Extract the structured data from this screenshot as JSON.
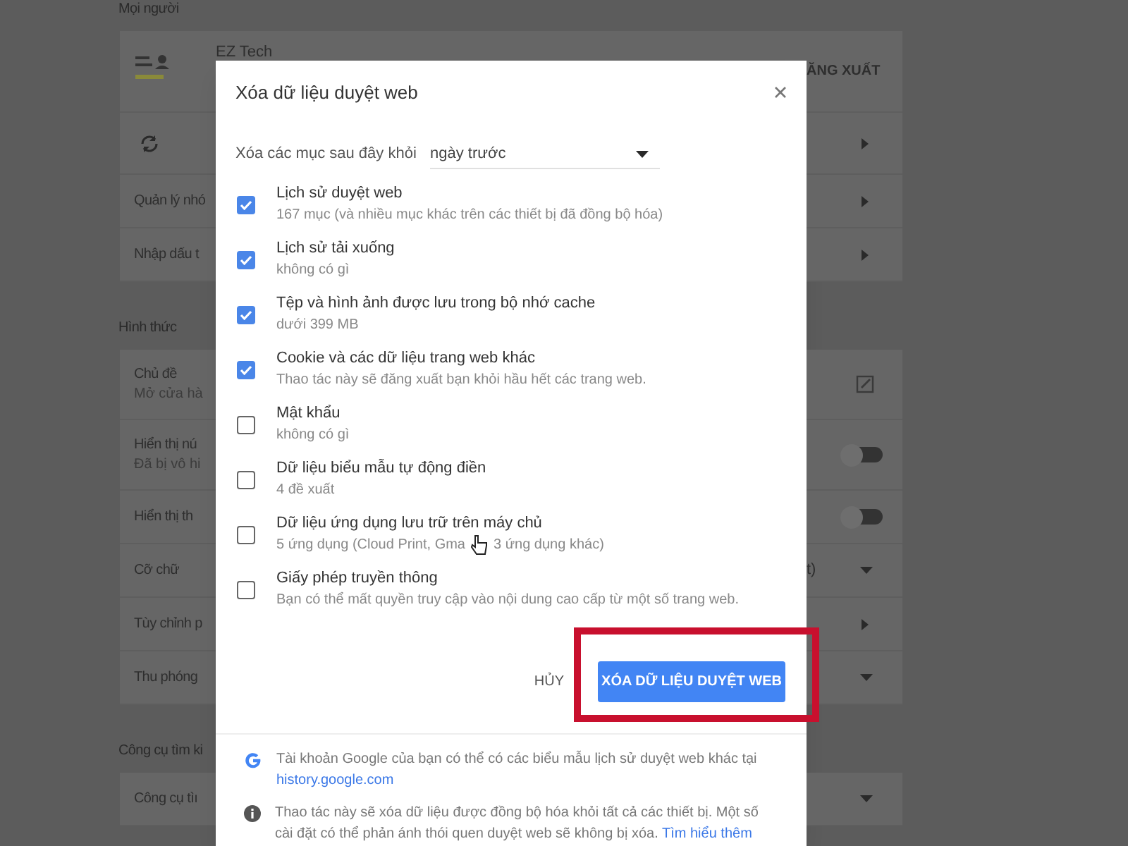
{
  "background": {
    "sections": [
      {
        "label": "Mọi người",
        "rows": [
          {
            "kind": "account",
            "label": "EZ Tech",
            "action": "ĂNG XUẤT"
          },
          {
            "kind": "sync"
          },
          {
            "kind": "link",
            "label": "Quản lý nhó"
          },
          {
            "kind": "link",
            "label": "Nhập dấu t"
          }
        ]
      },
      {
        "label": "Hình thức",
        "rows": [
          {
            "kind": "edit",
            "label": "Chủ đề",
            "sublabel": "Mở cửa hà"
          },
          {
            "kind": "toggle",
            "label": "Hiển thị nú",
            "sublabel": "Đã bị vô hi",
            "on": false
          },
          {
            "kind": "toggle",
            "label": "Hiển thị th",
            "on": false
          },
          {
            "kind": "select",
            "label": "Cỡ chữ",
            "value": "t)"
          },
          {
            "kind": "link",
            "label": "Tùy chỉnh p"
          },
          {
            "kind": "select",
            "label": "Thu phóng"
          }
        ]
      },
      {
        "label": "Công cụ tìm ki",
        "rows": [
          {
            "kind": "select",
            "label": "Công cụ tìı"
          }
        ]
      }
    ]
  },
  "dialog": {
    "title": "Xóa dữ liệu duyệt web",
    "range_label": "Xóa các mục sau đây khỏi",
    "range_value": "ngày trước",
    "items": [
      {
        "label": "Lịch sử duyệt web",
        "detail": "167 mục (và nhiều mục khác trên các thiết bị đã đồng bộ hóa)",
        "checked": true
      },
      {
        "label": "Lịch sử tải xuống",
        "detail": "không có gì",
        "checked": true
      },
      {
        "label": "Tệp và hình ảnh được lưu trong bộ nhớ cache",
        "detail": "dưới 399 MB",
        "checked": true
      },
      {
        "label": "Cookie và các dữ liệu trang web khác",
        "detail": "Thao tác này sẽ đăng xuất bạn khỏi hầu hết các trang web.",
        "checked": true
      },
      {
        "label": "Mật khẩu",
        "detail": "không có gì",
        "checked": false
      },
      {
        "label": "Dữ liệu biểu mẫu tự động điền",
        "detail": "4 đề xuất",
        "checked": false
      },
      {
        "label": "Dữ liệu ứng dụng lưu trữ trên máy chủ",
        "detail": "5 ứng dụng (Cloud Print, Gma",
        "detail_rest": "3 ứng dụng khác)",
        "checked": false
      },
      {
        "label": "Giấy phép truyền thông",
        "detail": "Bạn có thể mất quyền truy cập vào nội dung cao cấp từ một số trang web.",
        "checked": false
      }
    ],
    "cancel": "HỦY",
    "confirm": "XÓA DỮ LIỆU DUYỆT WEB",
    "notes": [
      {
        "kind": "google",
        "text": "Tài khoản Google của bạn có thể có các biểu mẫu lịch sử duyệt web khác tại",
        "link": "history.google.com"
      },
      {
        "kind": "info",
        "text": "Thao tác này sẽ xóa dữ liệu được đồng bộ hóa khỏi tất cả các thiết bị. Một số cài đặt có thể phản ánh thói quen duyệt web sẽ không bị xóa.",
        "link": "Tìm hiểu thêm"
      }
    ]
  }
}
